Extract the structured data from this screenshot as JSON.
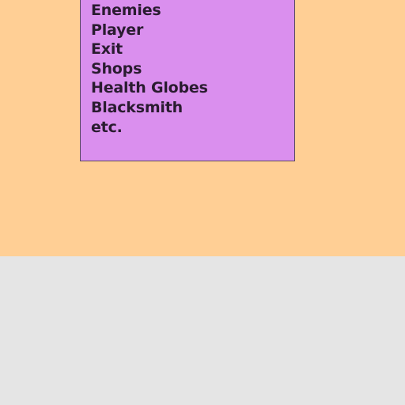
{
  "colors": {
    "top_background": "#ffcf95",
    "bottom_background": "#e5e5e5",
    "box_fill": "#da8fee",
    "box_border": "#5a4a5e",
    "text": "#2a1c30"
  },
  "list": {
    "items": [
      "Enemies",
      "Player",
      "Exit",
      "Shops",
      "Health Globes",
      "Blacksmith",
      "etc."
    ]
  }
}
